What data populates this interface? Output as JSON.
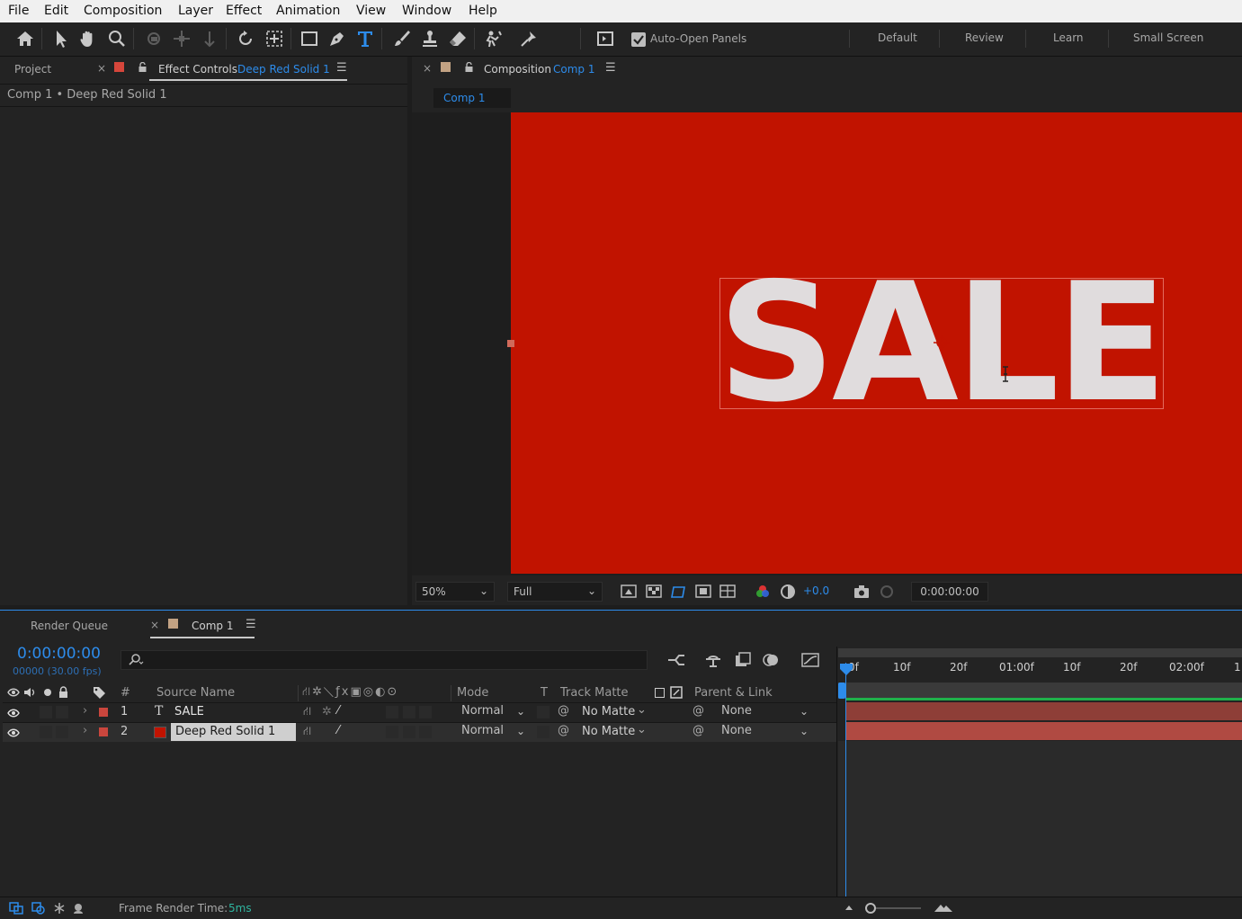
{
  "menu": [
    "File",
    "Edit",
    "Composition",
    "Layer",
    "Effect",
    "Animation",
    "View",
    "Window",
    "Help"
  ],
  "toolbar": {
    "tools": [
      "home-icon",
      "selection-tool-icon",
      "hand-tool-icon",
      "zoom-tool-icon",
      "orbit-camera-icon",
      "pan-camera-icon",
      "dolly-camera-icon",
      "rotation-tool-icon",
      "pan-behind-icon",
      "rectangle-tool-icon",
      "pen-tool-icon",
      "type-tool-icon",
      "brush-tool-icon",
      "clone-stamp-icon",
      "eraser-icon",
      "roto-brush-icon",
      "puppet-pin-icon"
    ],
    "active_tool": "type-tool-icon",
    "auto_open_label": "Auto-Open Panels",
    "auto_open_checked": true,
    "workspaces": [
      "Default",
      "Review",
      "Learn",
      "Small Screen"
    ]
  },
  "left_panel": {
    "project_tab": "Project",
    "effect_controls_label": "Effect Controls",
    "effect_controls_layer": "Deep Red Solid 1",
    "breadcrumb": "Comp 1 • Deep Red Solid 1"
  },
  "comp_panel": {
    "tab_label": "Composition",
    "tab_comp": "Comp 1",
    "subtab": "Comp 1",
    "canvas_text": "SALE",
    "zoom": "50%",
    "resolution": "Full",
    "exposure": "+0.0",
    "timecode": "0:00:00:00",
    "colors": {
      "background": "#c11300",
      "text": "#e0dcdd"
    }
  },
  "timeline": {
    "render_queue_tab": "Render Queue",
    "comp_tab": "Comp 1",
    "timecode": "0:00:00:00",
    "fps": "00000 (30.00 fps)",
    "search_placeholder": "",
    "columns": {
      "number": "#",
      "source_name": "Source Name",
      "mode": "Mode",
      "t": "T",
      "track_matte": "Track Matte",
      "parent": "Parent & Link"
    },
    "layers": [
      {
        "num": "1",
        "type_icon": "T",
        "name": "SALE",
        "mode": "Normal",
        "matte": "No Matte",
        "parent": "None",
        "label_color": "#c9463d",
        "selected": false
      },
      {
        "num": "2",
        "type_icon": "solid",
        "name": "Deep Red Solid 1",
        "mode": "Normal",
        "matte": "No Matte",
        "parent": "None",
        "label_color": "#c9463d",
        "selected": true
      }
    ],
    "ruler_ticks": [
      "0f",
      "10f",
      "20f",
      "01:00f",
      "10f",
      "20f",
      "02:00f",
      "1"
    ],
    "footer_label": "Frame Render Time:",
    "footer_value": "5ms"
  }
}
